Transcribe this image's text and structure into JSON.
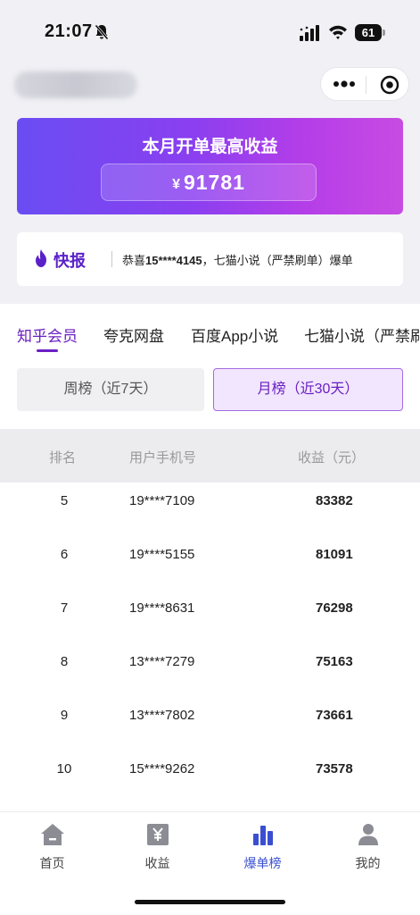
{
  "status_bar": {
    "time": "21:07",
    "battery": "61"
  },
  "banner": {
    "title": "本月开单最高收益",
    "currency": "¥",
    "amount": "91781"
  },
  "news": {
    "label": "快报",
    "prefix": "恭喜",
    "phone": "15****4145",
    "suffix": "，七猫小说（严禁刷单）爆单"
  },
  "categories": [
    {
      "label": "知乎会员",
      "active": true
    },
    {
      "label": "夸克网盘",
      "active": false
    },
    {
      "label": "百度App小说",
      "active": false
    },
    {
      "label": "七猫小说（严禁刷单）",
      "active": false
    }
  ],
  "periods": {
    "week": "周榜（近7天）",
    "month": "月榜（近30天）",
    "selected": "month"
  },
  "table": {
    "headers": {
      "rank": "排名",
      "phone": "用户手机号",
      "income": "收益（元）"
    },
    "rows": [
      {
        "rank": "5",
        "phone": "19****7109",
        "income": "83382"
      },
      {
        "rank": "6",
        "phone": "19****5155",
        "income": "81091"
      },
      {
        "rank": "7",
        "phone": "19****8631",
        "income": "76298"
      },
      {
        "rank": "8",
        "phone": "13****7279",
        "income": "75163"
      },
      {
        "rank": "9",
        "phone": "13****7802",
        "income": "73661"
      },
      {
        "rank": "10",
        "phone": "15****9262",
        "income": "73578"
      }
    ]
  },
  "nav": [
    {
      "label": "首页",
      "icon": "home-icon"
    },
    {
      "label": "收益",
      "icon": "yen-icon"
    },
    {
      "label": "爆单榜",
      "icon": "bar-chart-icon",
      "active": true
    },
    {
      "label": "我的",
      "icon": "person-icon"
    }
  ],
  "colors": {
    "accent": "#6a1fc2",
    "nav_active": "#3a4fd0",
    "banner_start": "#6a4df2",
    "banner_end": "#c74be3"
  }
}
